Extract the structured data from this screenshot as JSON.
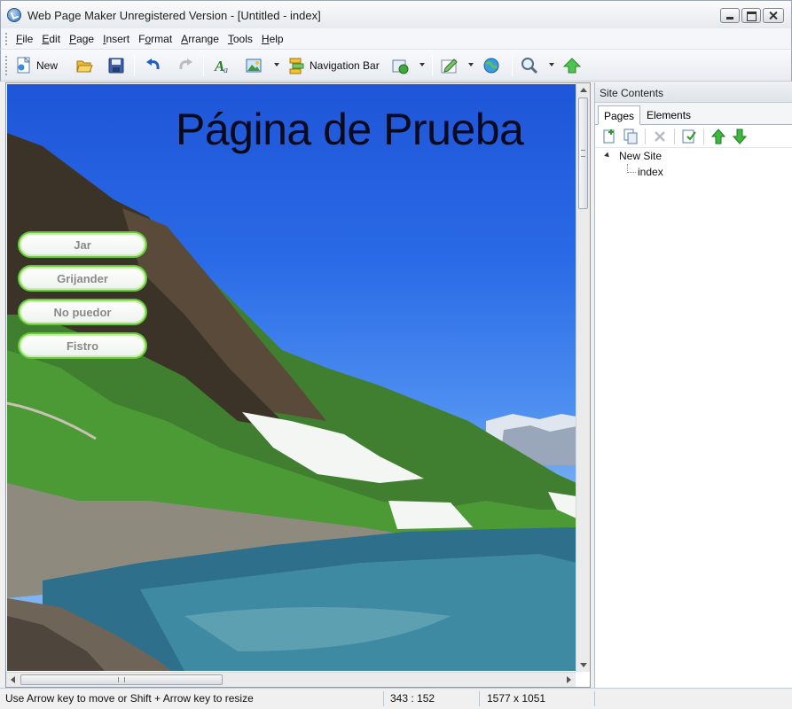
{
  "window": {
    "title": "Web Page Maker Unregistered Version - [Untitled - index]"
  },
  "menubar": {
    "items": [
      {
        "pre": "",
        "key": "F",
        "post": "ile"
      },
      {
        "pre": "",
        "key": "E",
        "post": "dit"
      },
      {
        "pre": "",
        "key": "P",
        "post": "age"
      },
      {
        "pre": "",
        "key": "I",
        "post": "nsert"
      },
      {
        "pre": "F",
        "key": "o",
        "post": "rmat"
      },
      {
        "pre": "",
        "key": "A",
        "post": "rrange"
      },
      {
        "pre": "",
        "key": "T",
        "post": "ools"
      },
      {
        "pre": "",
        "key": "H",
        "post": "elp"
      }
    ]
  },
  "toolbar": {
    "new_label": "New",
    "navbar_label": "Navigation Bar"
  },
  "canvas": {
    "page_title": "Página de Prueba",
    "nav_buttons": [
      "Jar",
      "Grijander",
      "No puedor",
      "Fistro"
    ]
  },
  "panel": {
    "title": "Site Contents",
    "tabs": [
      "Pages",
      "Elements"
    ],
    "tree": {
      "root": "New Site",
      "child": "index"
    }
  },
  "statusbar": {
    "hint": "Use Arrow key to move or Shift + Arrow key to resize",
    "position": "343 : 152",
    "size": "1577 x 1051"
  },
  "colors": {
    "nav_border": "#67c93a",
    "nav_text": "#8a8a8a",
    "sky": "#2a6ae6"
  }
}
